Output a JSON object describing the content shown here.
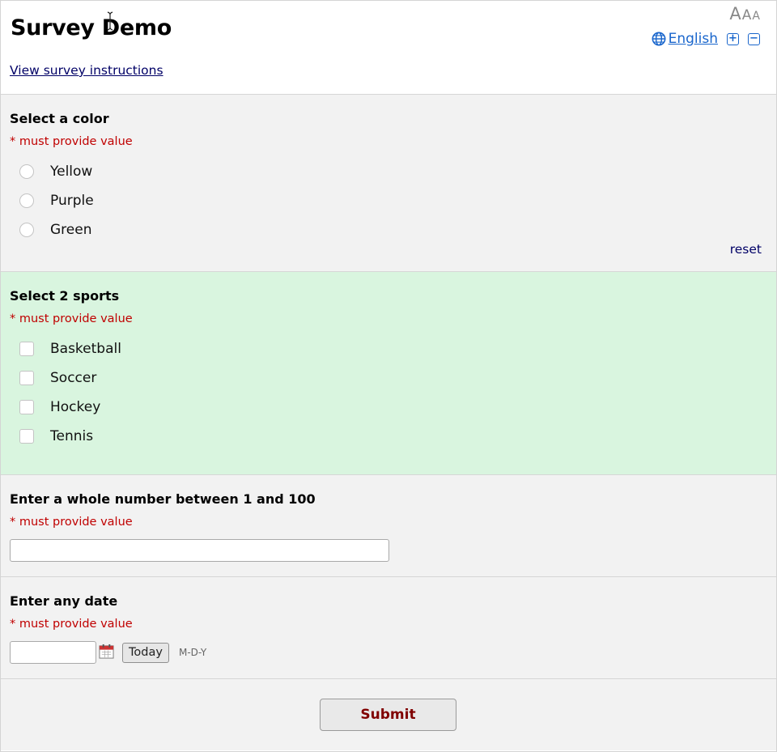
{
  "header": {
    "title": "Survey Demo",
    "instructions_link": "View survey instructions",
    "language": "English",
    "text_size_glyphs": [
      "A",
      "A",
      "A"
    ],
    "zoom_in": "+",
    "zoom_out": "−"
  },
  "required_text": "* must provide value",
  "q_color": {
    "label": "Select a color",
    "options": [
      "Yellow",
      "Purple",
      "Green"
    ],
    "reset": "reset"
  },
  "q_sports": {
    "label": "Select 2 sports",
    "options": [
      "Basketball",
      "Soccer",
      "Hockey",
      "Tennis"
    ]
  },
  "q_number": {
    "label": "Enter a whole number between 1 and 100",
    "value": ""
  },
  "q_date": {
    "label": "Enter any date",
    "value": "",
    "today_button": "Today",
    "format_hint": "M-D-Y"
  },
  "submit": {
    "label": "Submit"
  },
  "colors": {
    "required": "#c00000",
    "link": "#1a66cc",
    "green_section": "#d9f5df",
    "section_bg": "#f2f2f2",
    "submit_text": "#800000"
  },
  "icons": [
    "text-size-icon",
    "globe-icon",
    "zoom-in-icon",
    "zoom-out-icon",
    "calendar-icon",
    "text-cursor-icon"
  ]
}
